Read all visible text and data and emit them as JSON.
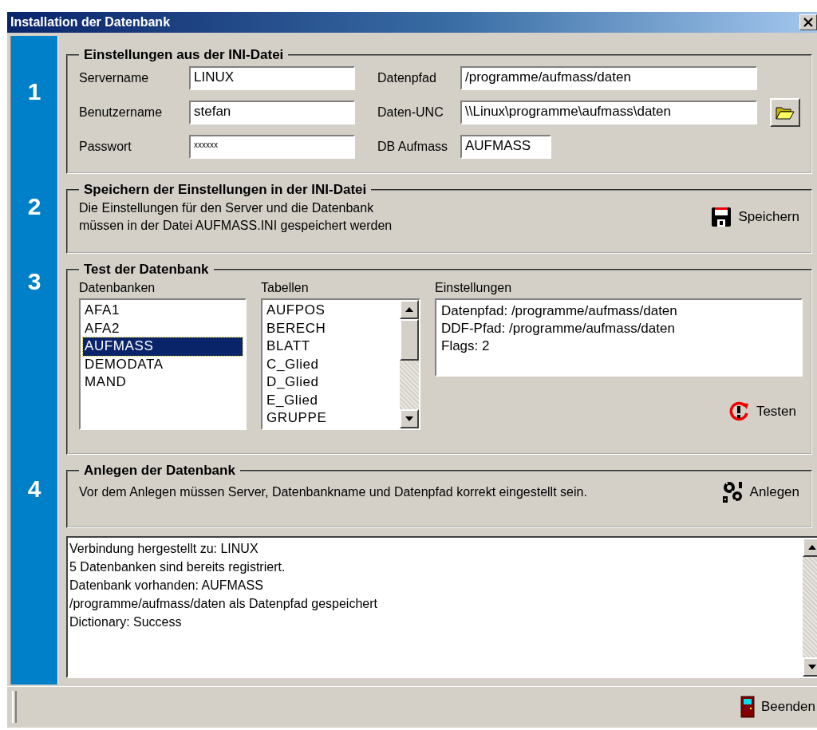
{
  "window": {
    "title": "Installation der Datenbank"
  },
  "sections": [
    {
      "kind": "settings",
      "number": "1",
      "title": "Einstellungen aus der INI-Datei",
      "columns": [
        [
          {
            "label": "Servername",
            "value": "LINUX",
            "kind": "wide"
          },
          {
            "label": "Benutzername",
            "value": "stefan",
            "kind": "wide"
          },
          {
            "label": "Passwort",
            "value": "xxxxxx",
            "kind": "password"
          }
        ],
        [
          {
            "label": "Datenpfad",
            "value": "/programme/aufmass/daten",
            "kind": "path"
          },
          {
            "label": "Daten-UNC",
            "value": "\\\\Linux\\programme\\aufmass\\daten",
            "kind": "browse"
          },
          {
            "label": "DB Aufmass",
            "value": "AUFMASS",
            "kind": "short"
          }
        ]
      ]
    },
    {
      "kind": "save",
      "number": "2",
      "title": "Speichern der Einstellungen in der INI-Datei",
      "text": [
        "Die Einstellungen für den Server und die Datenbank",
        "müssen in der Datei AUFMASS.INI gespeichert werden"
      ],
      "button": "Speichern"
    },
    {
      "kind": "test",
      "number": "3",
      "title": "Test der Datenbank",
      "databases": {
        "label": "Datenbanken",
        "items": [
          {
            "text": "AFA1",
            "selected": false
          },
          {
            "text": "AFA2",
            "selected": false
          },
          {
            "text": "AUFMASS",
            "selected": true
          },
          {
            "text": "DEMODATA",
            "selected": false
          },
          {
            "text": "MAND",
            "selected": false
          }
        ]
      },
      "tables": {
        "label": "Tabellen",
        "items": [
          "AUFPOS",
          "BERECH",
          "BLATT",
          "C_Glied",
          "D_Glied",
          "E_Glied",
          "GRUPPE"
        ]
      },
      "info": {
        "label": "Einstellungen",
        "lines": [
          "Datenpfad: /programme/aufmass/daten",
          "DDF-Pfad: /programme/aufmass/daten",
          "Flags: 2"
        ]
      },
      "button": "Testen"
    },
    {
      "kind": "create",
      "number": "4",
      "title": "Anlegen der Datenbank",
      "text": [
        "Vor dem Anlegen müssen Server, Datenbankname und Datenpfad korrekt eingestellt sein."
      ],
      "button": "Anlegen"
    }
  ],
  "log": {
    "lines": [
      "Verbindung hergestellt zu: LINUX",
      "5 Datenbanken sind bereits registriert.",
      "Datenbank vorhanden: AUFMASS",
      "/programme/aufmass/daten als Datenpfad gespeichert",
      "Dictionary: Success"
    ]
  },
  "footer": {
    "button": "Beenden"
  }
}
